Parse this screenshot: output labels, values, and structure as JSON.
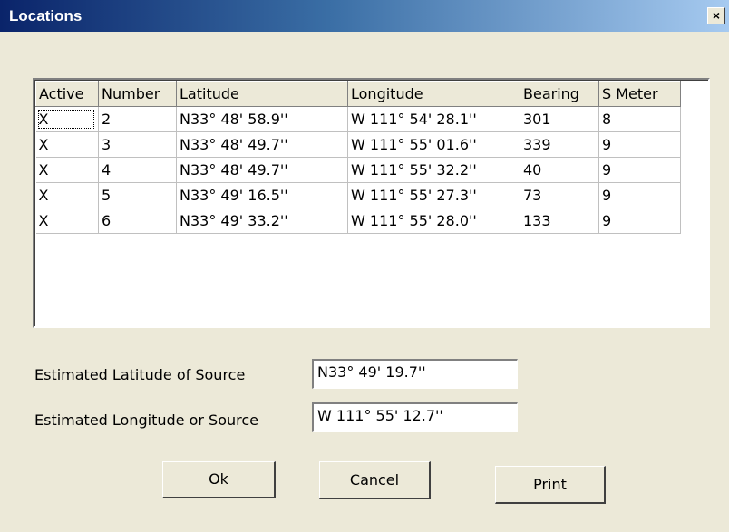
{
  "window": {
    "title": "Locations",
    "close_glyph": "×",
    "colors": {
      "title_gradient_start": "#0a246a",
      "title_gradient_end": "#a6caf0",
      "face": "#ece9d8"
    }
  },
  "table": {
    "columns": [
      "Active",
      "Number",
      "Latitude",
      "Longitude",
      "Bearing",
      "S Meter"
    ],
    "rows": [
      [
        "X",
        "2",
        "N33° 48' 58.9''",
        "W 111° 54' 28.1''",
        "301",
        "8"
      ],
      [
        "X",
        "3",
        "N33° 48' 49.7''",
        "W 111° 55' 01.6''",
        "339",
        "9"
      ],
      [
        "X",
        "4",
        "N33° 48' 49.7''",
        "W 111° 55' 32.2''",
        "40",
        "9"
      ],
      [
        "X",
        "5",
        "N33° 49' 16.5''",
        "W 111° 55' 27.3''",
        "73",
        "9"
      ],
      [
        "X",
        "6",
        "N33° 49' 33.2''",
        "W 111° 55' 28.0''",
        "133",
        "9"
      ]
    ]
  },
  "estimate": {
    "lat_label": "Estimated Latitude of Source",
    "lat_value": "N33° 49' 19.7''",
    "lon_label": "Estimated Longitude or Source",
    "lon_value": "W 111° 55' 12.7''"
  },
  "buttons": {
    "ok": "Ok",
    "cancel": "Cancel",
    "print": "Print"
  }
}
